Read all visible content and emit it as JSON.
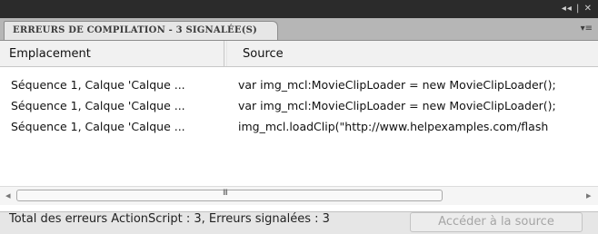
{
  "titlebar": {
    "controls": "◂◂ | ✕"
  },
  "tab": {
    "label": "ERREURS DE COMPILATION - 3 SIGNALÉE(S)"
  },
  "panel_menu_icon": "▾≡",
  "table": {
    "columns": [
      "Emplacement",
      "Source"
    ],
    "rows": [
      {
        "location": "Séquence 1, Calque 'Calque ...",
        "source": "var img_mcl:MovieClipLoader = new MovieClipLoader();"
      },
      {
        "location": "Séquence 1, Calque 'Calque ...",
        "source": "var img_mcl:MovieClipLoader = new MovieClipLoader();"
      },
      {
        "location": "Séquence 1, Calque 'Calque ...",
        "source": "img_mcl.loadClip(\"http://www.helpexamples.com/flash"
      }
    ]
  },
  "scrollbar": {
    "left_arrow": "◂",
    "right_arrow": "▸",
    "grip": "III"
  },
  "status": {
    "summary": "Total des erreurs ActionScript : 3,  Erreurs signalées : 3",
    "goto_button": "Accéder à la source"
  }
}
